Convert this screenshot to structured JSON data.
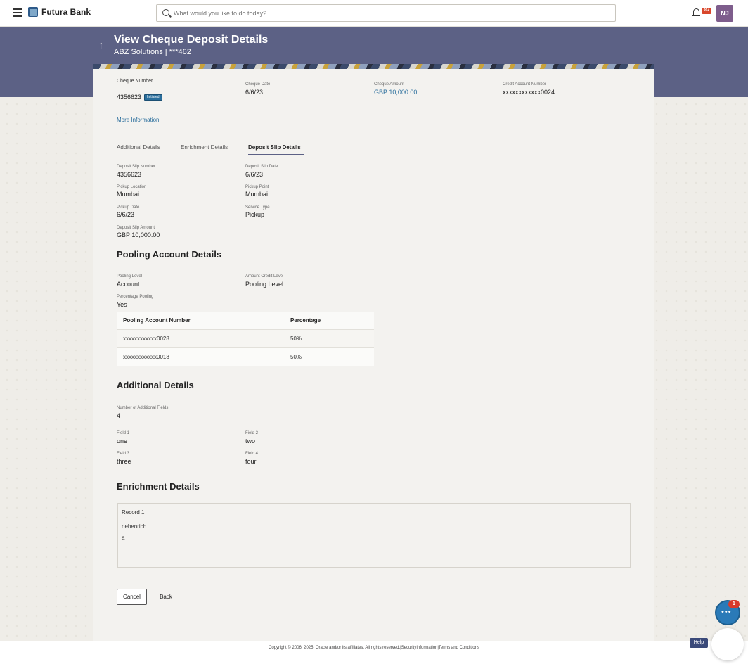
{
  "topbar": {
    "brand": "Futura Bank",
    "search_placeholder": "What would you like to do today?",
    "notification_badge": "99+",
    "avatar_initials": "NJ"
  },
  "header": {
    "title": "View Cheque Deposit Details",
    "subtitle": "ABZ Solutions | ***462"
  },
  "summary": {
    "cheque_number_label": "Cheque Number",
    "cheque_number": "4356623",
    "status": "Initiated",
    "cheque_date_label": "Cheque Date",
    "cheque_date": "6/6/23",
    "cheque_amount_label": "Cheque Amount",
    "cheque_amount": "GBP 10,000.00",
    "credit_account_label": "Credit Account Number",
    "credit_account": "xxxxxxxxxxxx0024",
    "more_info": "More Information"
  },
  "tabs": [
    {
      "label": "Additional Details"
    },
    {
      "label": "Enrichment Details"
    },
    {
      "label": "Deposit Slip Details"
    }
  ],
  "deposit_slip": {
    "slip_number_label": "Deposit Slip Number",
    "slip_number": "4356623",
    "slip_date_label": "Deposit Slip Date",
    "slip_date": "6/6/23",
    "pickup_location_label": "Pickup Location",
    "pickup_location": "Mumbai",
    "pickup_point_label": "Pickup Point",
    "pickup_point": "Mumbai",
    "pickup_date_label": "Pickup Date",
    "pickup_date": "6/6/23",
    "service_type_label": "Service Type",
    "service_type": "Pickup",
    "slip_amount_label": "Deposit Slip Amount",
    "slip_amount": "GBP 10,000.00"
  },
  "pooling": {
    "title": "Pooling Account Details",
    "level_label": "Pooling Level",
    "level": "Account",
    "credit_level_label": "Amount Credit Level",
    "credit_level": "Pooling Level",
    "pct_pooling_label": "Percentage Pooling",
    "pct_pooling": "Yes",
    "table_headers": [
      "Pooling Account Number",
      "Percentage"
    ],
    "rows": [
      {
        "account": "xxxxxxxxxxxx0028",
        "percentage": "50%"
      },
      {
        "account": "xxxxxxxxxxxx0018",
        "percentage": "50%"
      }
    ]
  },
  "additional": {
    "title": "Additional Details",
    "count_label": "Number of Additional Fields",
    "count": "4",
    "field1_label": "Field 1",
    "field1": "one",
    "field2_label": "Field 2",
    "field2": "two",
    "field3_label": "Field 3",
    "field3": "three",
    "field4_label": "Field 4",
    "field4": "four"
  },
  "enrichment": {
    "title": "Enrichment Details",
    "record_title": "Record 1",
    "line1": "nehenrich",
    "line2": "a"
  },
  "actions": {
    "cancel": "Cancel",
    "back": "Back"
  },
  "footer": {
    "text": "Copyright © 2006, 2025, Oracle and/or its affiliates. All rights reserved.|SecurityInformation|Terms and Conditions"
  },
  "help": {
    "chat_count": "1",
    "label": "Help"
  }
}
